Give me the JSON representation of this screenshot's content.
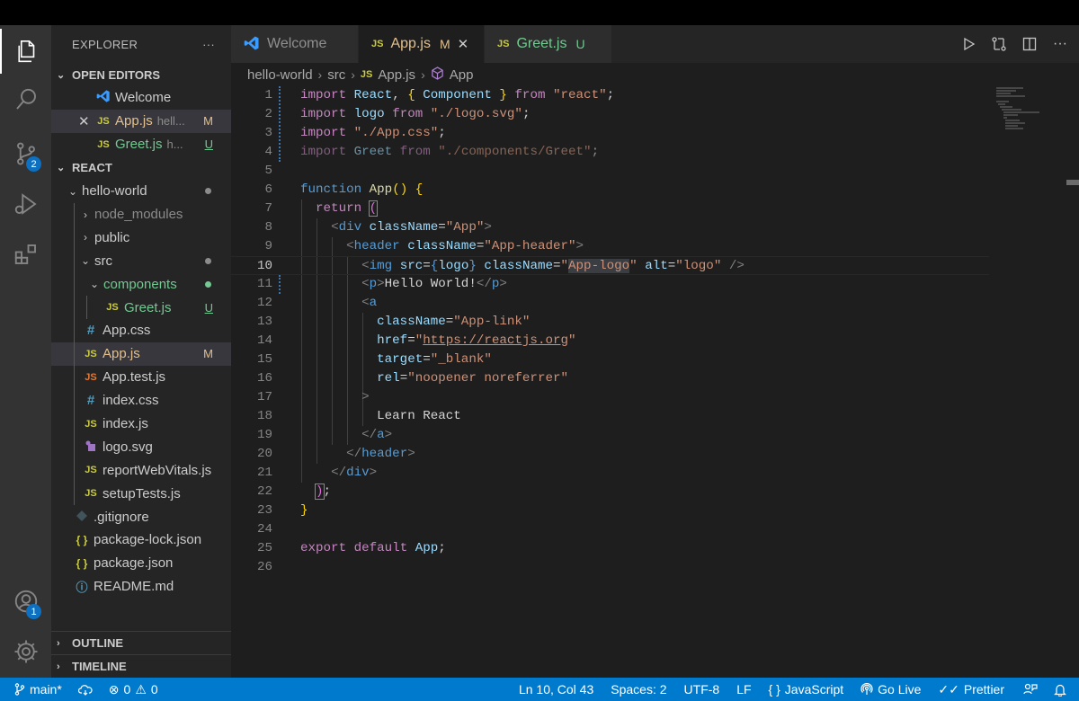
{
  "explorer": {
    "title": "EXPLORER",
    "more": "···",
    "open_editors": {
      "label": "OPEN EDITORS",
      "items": [
        {
          "icon": "vscode-icon",
          "name": "Welcome",
          "hint": "",
          "status": ""
        },
        {
          "icon": "JS",
          "name": "App.js",
          "hint": "hell...",
          "status": "M"
        },
        {
          "icon": "JS",
          "name": "Greet.js",
          "hint": "h...",
          "status": "U"
        }
      ]
    },
    "workspace": {
      "label": "REACT",
      "root": "hello-world",
      "items": {
        "node_modules": "node_modules",
        "public": "public",
        "src": "src",
        "components": "components",
        "greet": "Greet.js",
        "greet_status": "U",
        "app_css": "App.css",
        "app_js": "App.js",
        "app_js_status": "M",
        "app_test": "App.test.js",
        "index_css": "index.css",
        "index_js": "index.js",
        "logo": "logo.svg",
        "report": "reportWebVitals.js",
        "setup": "setupTests.js",
        "gitignore": ".gitignore",
        "package_lock": "package-lock.json",
        "package": "package.json",
        "readme": "README.md"
      },
      "icon_js": "JS",
      "icon_css": "#",
      "icon_json": "{ }"
    },
    "outline": "OUTLINE",
    "timeline": "TIMELINE"
  },
  "activity": {
    "scm_badge": "2",
    "account_badge": "1"
  },
  "tabs": [
    {
      "label": "Welcome",
      "status": ""
    },
    {
      "label": "App.js",
      "status": "M"
    },
    {
      "label": "Greet.js",
      "status": "U"
    }
  ],
  "breadcrumb": [
    "hello-world",
    "src",
    "App.js",
    "App"
  ],
  "editor": {
    "line_numbers": [
      "1",
      "2",
      "3",
      "4",
      "5",
      "6",
      "7",
      "8",
      "9",
      "10",
      "11",
      "12",
      "13",
      "14",
      "15",
      "16",
      "17",
      "18",
      "19",
      "20",
      "21",
      "22",
      "23",
      "24",
      "25",
      "26"
    ]
  },
  "status": {
    "branch": "main*",
    "errors": "0",
    "warnings": "0",
    "position": "Ln 10, Col 43",
    "spaces": "Spaces: 2",
    "encoding": "UTF-8",
    "eol": "LF",
    "language": "JavaScript",
    "golive": "Go Live",
    "prettier": "Prettier"
  },
  "colors": {
    "statusbar": "#007acc",
    "modified": "#e2c08d",
    "untracked": "#73c991"
  }
}
